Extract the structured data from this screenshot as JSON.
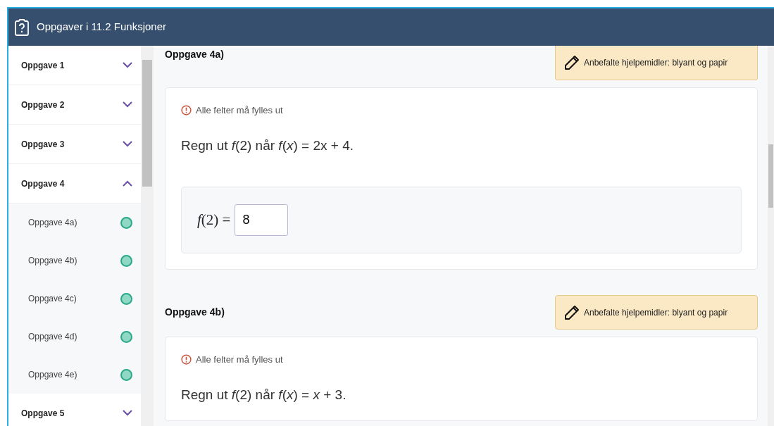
{
  "window": {
    "title": "Oppgaver i 11.2 Funksjoner"
  },
  "sidebar": {
    "items": [
      {
        "label": "Oppgave 1",
        "expanded": false
      },
      {
        "label": "Oppgave 2",
        "expanded": false
      },
      {
        "label": "Oppgave 3",
        "expanded": false
      },
      {
        "label": "Oppgave 4",
        "expanded": true,
        "children": [
          {
            "label": "Oppgave 4a)",
            "color": "#8fd8c3"
          },
          {
            "label": "Oppgave 4b)",
            "color": "#8fd8c3"
          },
          {
            "label": "Oppgave 4c)",
            "color": "#8fd8c3"
          },
          {
            "label": "Oppgave 4d)",
            "color": "#8fd8c3"
          },
          {
            "label": "Oppgave 4e)",
            "color": "#8fd8c3"
          }
        ]
      },
      {
        "label": "Oppgave 5",
        "expanded": false
      }
    ]
  },
  "tasks": [
    {
      "title": "Oppgave 4a)",
      "aid": "Anbefalte hjelpemidler: blyant og papir",
      "warning": "Alle felter må fylles ut",
      "question": "Regn ut *f*(2) når *f*(*x*) = 2x + 4.",
      "answer": {
        "label": "*f*(2) =",
        "value": "8"
      }
    },
    {
      "title": "Oppgave 4b)",
      "aid": "Anbefalte hjelpemidler: blyant og papir",
      "warning": "Alle felter må fylles ut",
      "question": "Regn ut *f*(2) når *f*(*x*) = *x* + 3."
    }
  ]
}
